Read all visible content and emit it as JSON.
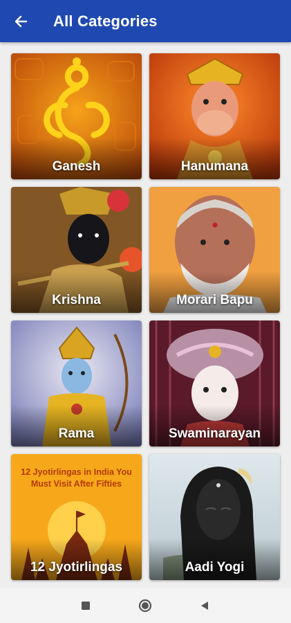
{
  "appbar": {
    "title": "All Categories",
    "back_icon": "arrow-left-icon"
  },
  "categories": [
    {
      "label": "Ganesh",
      "image": "ganesh-image"
    },
    {
      "label": "Hanumana",
      "image": "hanumana-image"
    },
    {
      "label": "Krishna",
      "image": "krishna-image"
    },
    {
      "label": "Morari Bapu",
      "image": "morari-bapu-image"
    },
    {
      "label": "Rama",
      "image": "rama-image"
    },
    {
      "label": "Swaminarayan",
      "image": "swaminarayan-image"
    },
    {
      "label": "12 Jyotirlingas",
      "image": "jyotirlingas-poster",
      "poster_text": "12 Jyotirlingas in India You Must Visit After Fifties"
    },
    {
      "label": "Aadi Yogi",
      "image": "aadi-yogi-image"
    }
  ],
  "navbar": {
    "icons": [
      "recents-square-icon",
      "home-circle-icon",
      "back-triangle-icon"
    ]
  },
  "colors": {
    "appbar": "#1f49b0",
    "background": "#eeeeee"
  }
}
